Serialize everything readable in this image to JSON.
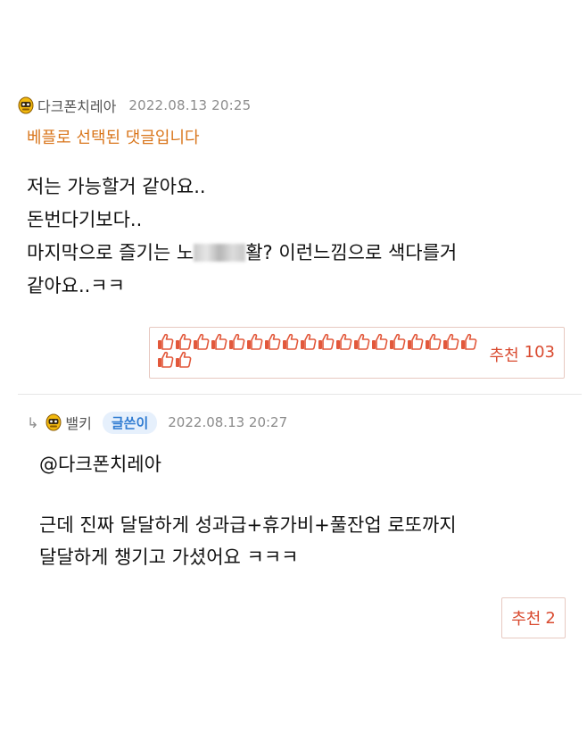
{
  "comment1": {
    "username": "다크폰치레아",
    "timestamp": "2022.08.13 20:25",
    "best_label": "베플로 선택된 댓글입니다",
    "lines": [
      "저는 가능할거 같아요..",
      "돈번다기보다..",
      "마지막으로 즐기는 노",
      "활? 이런느낌으로 색다를거",
      "같아요..ㅋㅋ"
    ],
    "thumb_count": 20,
    "thumb_icon": "thumbs-up-icon",
    "reco_label": "추천",
    "reco_count": "103"
  },
  "comment2": {
    "reply_icon": "reply-arrow-icon",
    "username": "밸키",
    "author_badge": "글쓴이",
    "timestamp": "2022.08.13 20:27",
    "mention": "@다크폰치레아",
    "lines": [
      "근데 진짜 달달하게 성과급+휴가비+풀잔업 로또까지",
      "달달하게 챙기고 가셨어요 ㅋㅋㅋ"
    ],
    "reco_label": "추천",
    "reco_count": "2"
  },
  "colors": {
    "best_label": "#d9761c",
    "reco": "#d94a2f",
    "badge_bg": "#e6f0fc",
    "badge_text": "#2f7bd1",
    "avatar": "#e6a800"
  }
}
